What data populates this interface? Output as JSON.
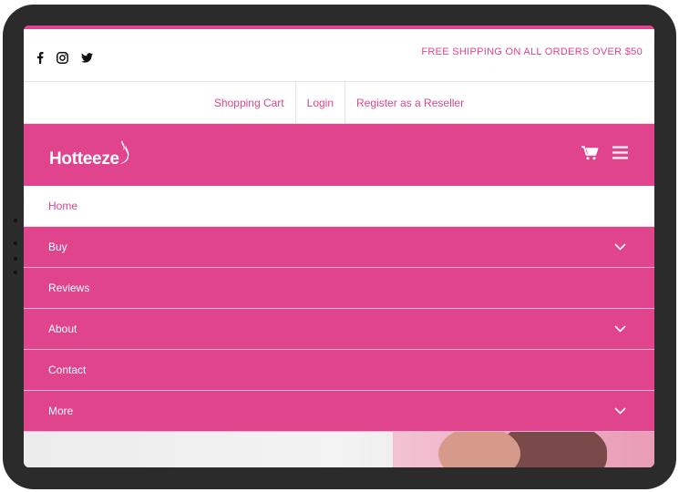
{
  "topbar": {
    "social": [
      {
        "icon": "facebook-icon"
      },
      {
        "icon": "instagram-icon"
      },
      {
        "icon": "twitter-icon"
      }
    ],
    "shipping_text": "FREE SHIPPING ON ALL ORDERS OVER $50"
  },
  "account_links": [
    "Shopping Cart",
    "Login",
    "Register as a Reseller"
  ],
  "header": {
    "logo_text": "Hotteeze",
    "icons": [
      "cart-icon",
      "hamburger-menu-icon"
    ]
  },
  "menu": [
    {
      "label": "Home",
      "has_submenu": false,
      "active": true
    },
    {
      "label": "Buy",
      "has_submenu": true
    },
    {
      "label": "Reviews",
      "has_submenu": false
    },
    {
      "label": "About",
      "has_submenu": true
    },
    {
      "label": "Contact",
      "has_submenu": false
    },
    {
      "label": "More",
      "has_submenu": true
    }
  ],
  "colors": {
    "brand": "#e0448c",
    "frame": "#2b2b2b"
  }
}
